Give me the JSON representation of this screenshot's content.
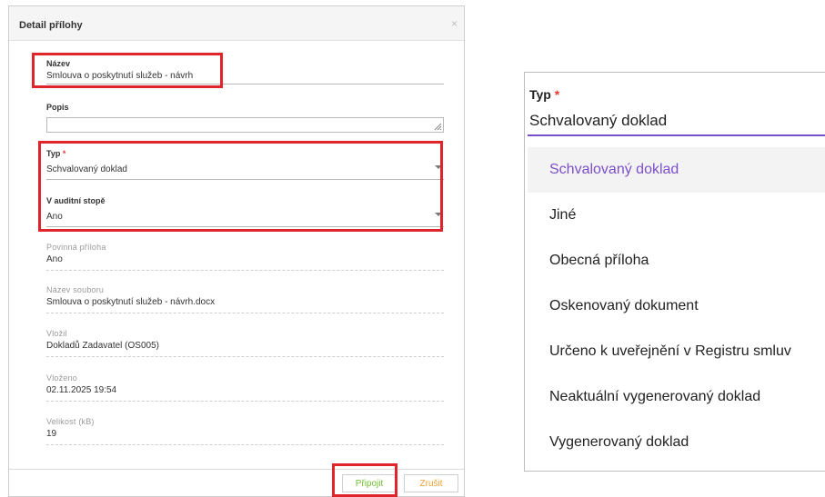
{
  "dialog": {
    "title": "Detail přílohy",
    "close_glyph": "×",
    "fields": {
      "nazev": {
        "label": "Název",
        "value": "Smlouva o poskytnutí služeb - návrh"
      },
      "popis": {
        "label": "Popis",
        "value": ""
      },
      "typ": {
        "label": "Typ",
        "required_mark": "*",
        "value": "Schvalovaný doklad"
      },
      "audit": {
        "label": "V auditní stopě",
        "value": "Ano"
      },
      "povinna": {
        "label": "Povinná příloha",
        "value": "Ano"
      },
      "soubor": {
        "label": "Název souboru",
        "value": "Smlouva o poskytnutí služeb - návrh.docx"
      },
      "vlozil": {
        "label": "Vložil",
        "value": "Dokladů Zadavatel (OS005)"
      },
      "vlozeno": {
        "label": "Vloženo",
        "value": "02.11.2025 19:54"
      },
      "velikost": {
        "label": "Velikost (kB)",
        "value": "19"
      }
    },
    "buttons": {
      "attach": "Připojit",
      "cancel": "Zrušit"
    }
  },
  "type_dropdown": {
    "label": "Typ",
    "required_mark": "*",
    "selected": "Schvalovaný doklad",
    "options": [
      "Schvalovaný doklad",
      "Jiné",
      "Obecná příloha",
      "Oskenovaný dokument",
      "Určeno k uveřejnění v Registru smluv",
      "Neaktuální vygenerovaný doklad",
      "Vygenerovaný doklad"
    ]
  },
  "colors": {
    "highlight": "#e0242b",
    "accent_purple": "#7b4fc9",
    "required": "#e53935",
    "attach_text": "#6fbf30",
    "cancel_text": "#f0a030"
  },
  "icons": {
    "close": "close-icon",
    "caret": "chevron-down-icon",
    "resize": "resize-grip-icon"
  }
}
